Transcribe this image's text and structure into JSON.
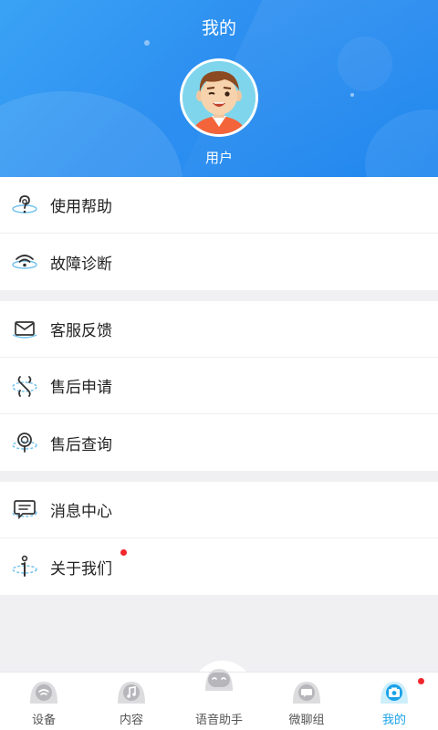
{
  "header": {
    "title": "我的",
    "username": "用户"
  },
  "menu_groups": [
    {
      "items": [
        {
          "label": "使用帮助",
          "icon": "help-icon"
        },
        {
          "label": "故障诊断",
          "icon": "wifi-diagnose-icon"
        }
      ]
    },
    {
      "items": [
        {
          "label": "客服反馈",
          "icon": "mail-feedback-icon"
        },
        {
          "label": "售后申请",
          "icon": "wrench-icon"
        },
        {
          "label": "售后查询",
          "icon": "search-query-icon"
        }
      ]
    },
    {
      "items": [
        {
          "label": "消息中心",
          "icon": "message-icon"
        },
        {
          "label": "关于我们",
          "icon": "info-icon",
          "badge": true
        }
      ]
    }
  ],
  "tabs": [
    {
      "label": "设备",
      "icon": "device-icon",
      "active": false
    },
    {
      "label": "内容",
      "icon": "music-icon",
      "active": false
    },
    {
      "label": "语音助手",
      "icon": "voice-assistant-icon",
      "active": false
    },
    {
      "label": "微聊组",
      "icon": "chat-icon",
      "active": false
    },
    {
      "label": "我的",
      "icon": "camera-icon",
      "active": true,
      "badge": true
    }
  ],
  "colors": {
    "header_blue": "#2d8ff0",
    "accent": "#1ba2e8",
    "badge_red": "#f2262d"
  }
}
